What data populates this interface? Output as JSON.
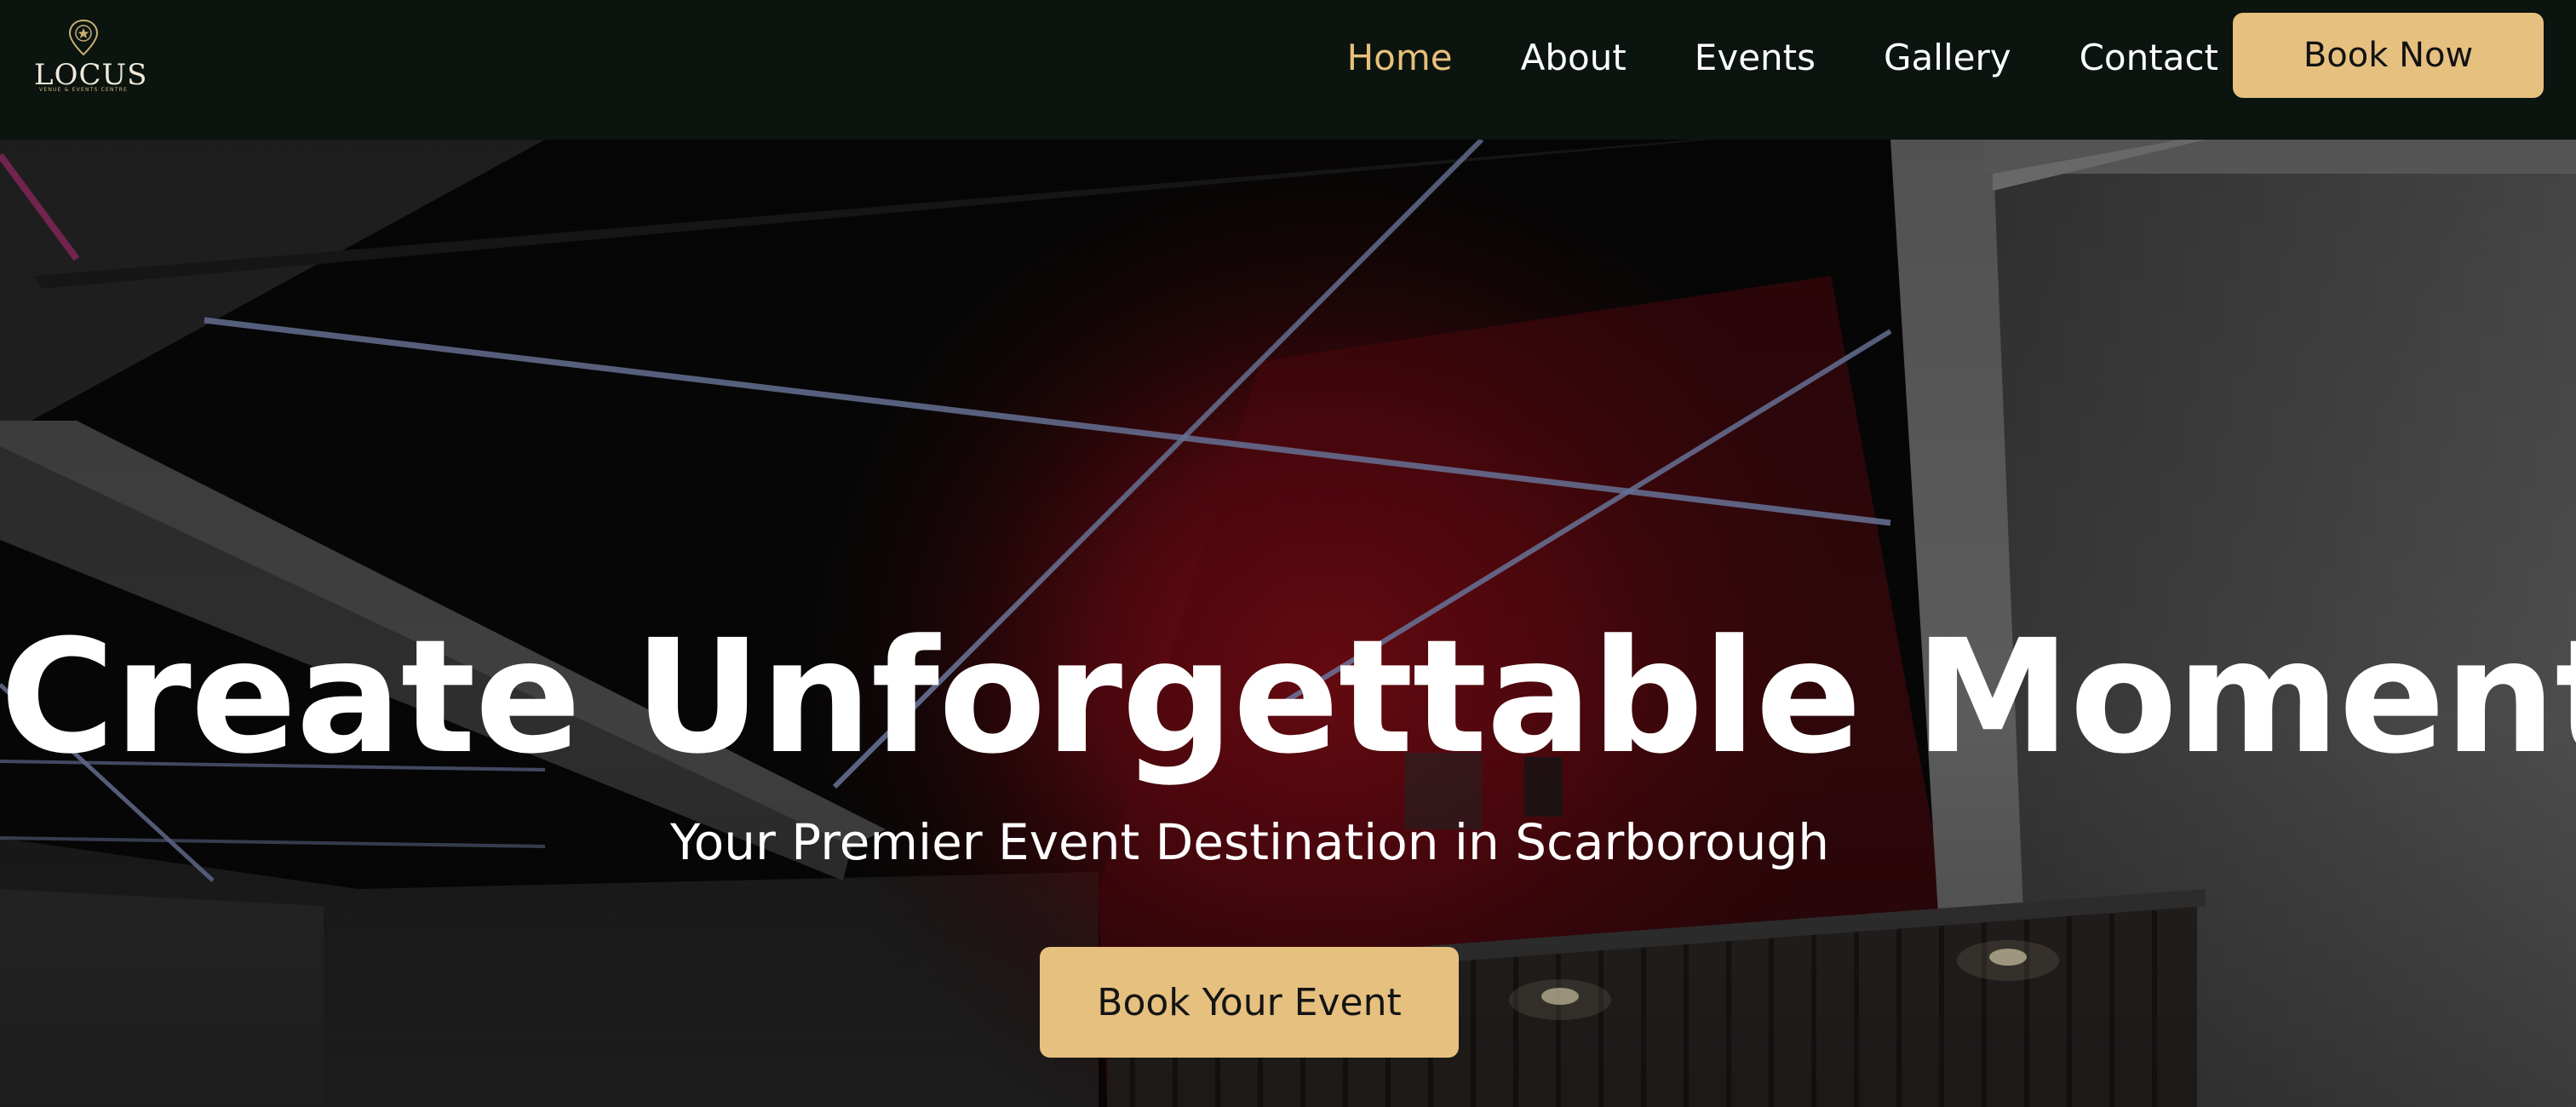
{
  "brand": {
    "name": "LOCUS",
    "tagline": "VENUE & EVENTS CENTRE",
    "logo_icon": "map-pin-star-icon"
  },
  "nav": {
    "items": [
      {
        "label": "Home",
        "active": true
      },
      {
        "label": "About",
        "active": false
      },
      {
        "label": "Events",
        "active": false
      },
      {
        "label": "Gallery",
        "active": false
      },
      {
        "label": "Contact",
        "active": false
      }
    ],
    "cta_label": "Book Now"
  },
  "hero": {
    "title": "Create Unforgettable Moments",
    "subtitle": "Your Premier Event Destination in Scarborough",
    "cta_label": "Book Your Event"
  },
  "colors": {
    "nav_background": "#0b140f",
    "accent_gold": "#e6c07f",
    "active_link": "#e8bf7b",
    "text_light": "#ffffff"
  }
}
